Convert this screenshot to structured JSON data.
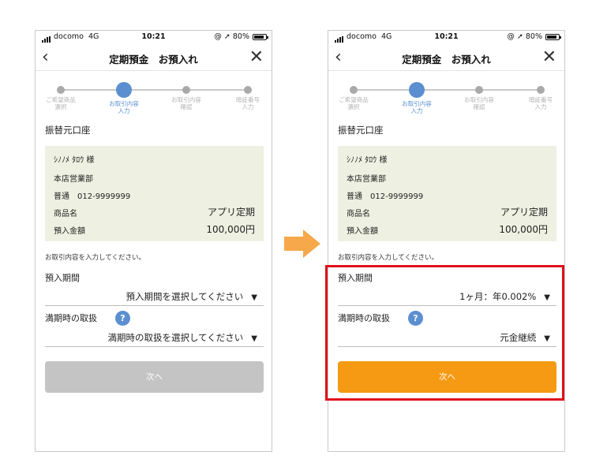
{
  "status": {
    "carrier": "docomo",
    "network": "4G",
    "time": "10:21",
    "indicators": "@ ➚ 80%"
  },
  "nav": {
    "title": "定期預金　お預入れ",
    "back_icon": "chevron-left-icon",
    "close_icon": "close-icon"
  },
  "steps": [
    {
      "line1": "ご希望商品",
      "line2": "選択"
    },
    {
      "line1": "お取引内容",
      "line2": "入力"
    },
    {
      "line1": "お取引内容",
      "line2": "確認"
    },
    {
      "line1": "暗証番号",
      "line2": "入力"
    }
  ],
  "account": {
    "section_title": "振替元口座",
    "name": "ｼﾉﾉﾒ ﾀﾛｳ 様",
    "branch": "本店営業部",
    "number": "普通　012-9999999",
    "product_label": "商品名",
    "product_value": "アプリ定期",
    "amount_label": "預入金額",
    "amount_value": "100,000円"
  },
  "instruction": "お取引内容を入力してください。",
  "form": {
    "period_label": "預入期間",
    "maturity_label": "満期時の取扱",
    "help_icon": "?",
    "caret": "▼"
  },
  "left": {
    "period_value": "預入期間を選択してください",
    "maturity_value": "満期時の取扱を選択してください",
    "next_label": "次へ"
  },
  "right": {
    "period_value": "1ヶ月：年0.002%",
    "maturity_value": "元金継続",
    "next_label": "次へ"
  },
  "colors": {
    "accent_blue": "#5b8fd0",
    "next_enabled": "#f59a12",
    "next_disabled": "#c4c4c4",
    "highlight": "#e0101a",
    "arrow": "#f6a84a",
    "info_bg": "#eef1e2"
  }
}
